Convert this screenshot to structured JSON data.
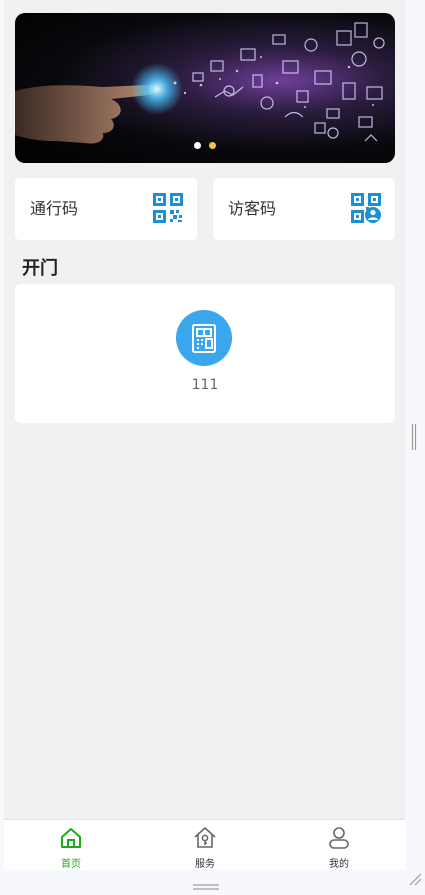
{
  "banner": {
    "slide_count": 2,
    "active_index": 1,
    "colors": {
      "dot": "#ffffff",
      "dot_active": "#f5c342"
    }
  },
  "cards": {
    "pass_code": {
      "label": "通行码",
      "icon": "qr-code-icon"
    },
    "visitor_code": {
      "label": "访客码",
      "icon": "visitor-qr-code-icon"
    }
  },
  "section": {
    "title": "开门"
  },
  "doors": [
    {
      "name": "111",
      "icon": "door-intercom-icon"
    }
  ],
  "tabbar": {
    "items": [
      {
        "label": "首页",
        "icon": "home-icon",
        "active": true
      },
      {
        "label": "服务",
        "icon": "service-house-icon",
        "active": false
      },
      {
        "label": "我的",
        "icon": "user-icon",
        "active": false
      }
    ],
    "colors": {
      "active": "#1aad19",
      "inactive": "#333333"
    }
  },
  "colors": {
    "accent_blue": "#1d8fd6",
    "door_circle": "#39a6ee",
    "background": "#f1f1f1"
  }
}
